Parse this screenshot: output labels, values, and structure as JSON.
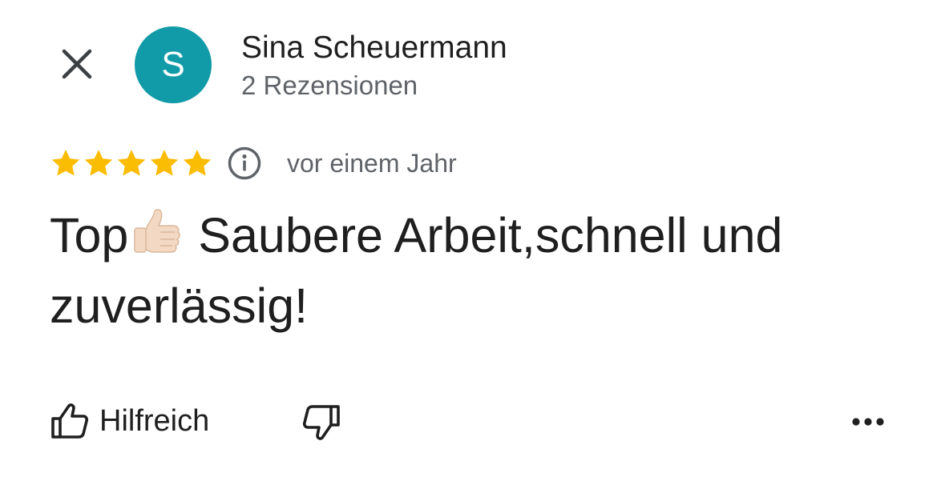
{
  "header": {
    "close_icon": "close-icon",
    "avatar_initial": "S",
    "avatar_color": "#119aa8",
    "author_name": "Sina Scheuermann",
    "author_reviews": "2 Rezensionen"
  },
  "rating": {
    "stars": 5,
    "max_stars": 5,
    "star_color": "#fbbc04",
    "info_icon": "info-icon",
    "time": "vor einem Jahr"
  },
  "review": {
    "text_before_emoji": "Top",
    "emoji_icon": "thumbs-up-emoji",
    "text_after_emoji": " Saubere Arbeit,schnell und zuverlässig!"
  },
  "actions": {
    "helpful_icon": "thumbs-up-outline-icon",
    "helpful_label": "Hilfreich",
    "unhelpful_icon": "thumbs-down-outline-icon",
    "more_icon": "more-horizontal-icon"
  }
}
